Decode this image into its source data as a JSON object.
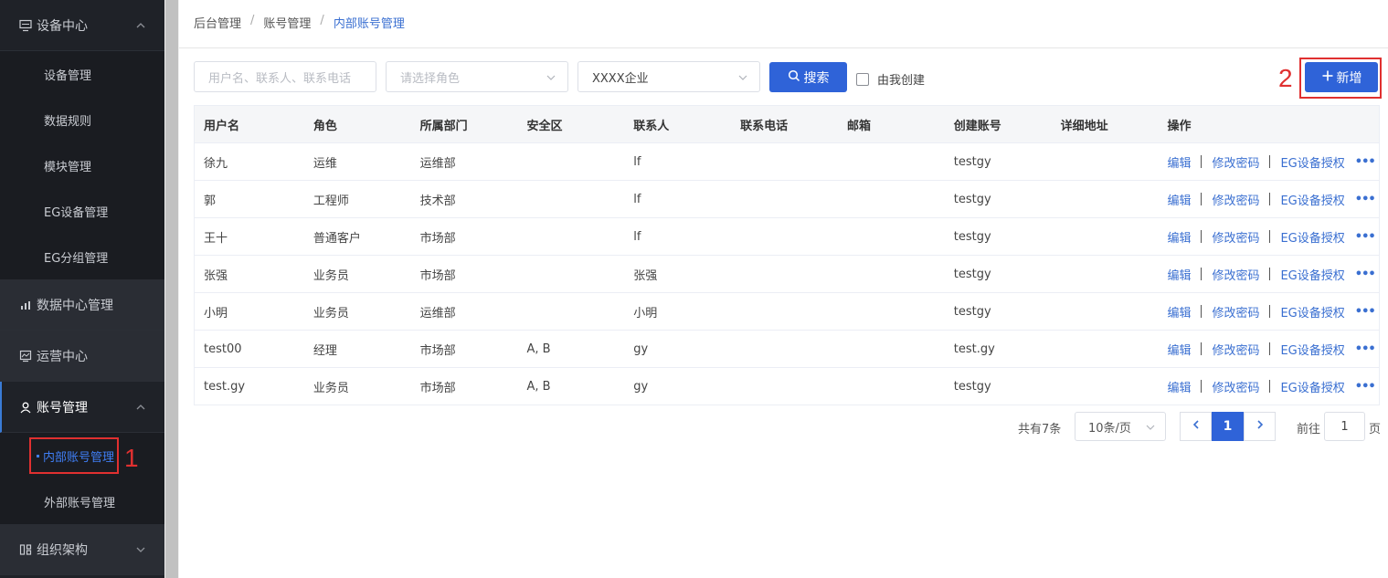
{
  "sidebar": {
    "groups": [
      {
        "label": "设备中心",
        "icon": "monitor-icon"
      },
      {
        "label": "数据中心管理",
        "icon": "chart-icon"
      },
      {
        "label": "运营中心",
        "icon": "dashboard-icon"
      },
      {
        "label": "账号管理",
        "icon": "user-icon"
      },
      {
        "label": "组织架构",
        "icon": "org-icon"
      }
    ],
    "device_items": [
      "设备管理",
      "数据规则",
      "模块管理",
      "EG设备管理",
      "EG分组管理"
    ],
    "account_items": [
      "内部账号管理",
      "外部账号管理"
    ]
  },
  "annotations": {
    "marker1": "1",
    "marker2": "2"
  },
  "breadcrumb": {
    "items": [
      "后台管理",
      "账号管理",
      "内部账号管理"
    ],
    "separator": "/"
  },
  "filters": {
    "keyword_placeholder": "用户名、联系人、联系电话",
    "role_placeholder": "请选择角色",
    "company_value": "XXXX企业",
    "search_label": "搜索",
    "created_by_me_label": "由我创建",
    "add_label": "新增"
  },
  "table": {
    "columns": [
      "用户名",
      "角色",
      "所属部门",
      "安全区",
      "联系人",
      "联系电话",
      "邮箱",
      "创建账号",
      "详细地址",
      "操作"
    ],
    "rows": [
      [
        "徐九",
        "运维",
        "运维部",
        "",
        "lf",
        "",
        "",
        "testgy",
        ""
      ],
      [
        "郭",
        "工程师",
        "技术部",
        "",
        "lf",
        "",
        "",
        "testgy",
        ""
      ],
      [
        "王十",
        "普通客户",
        "市场部",
        "",
        "lf",
        "",
        "",
        "testgy",
        ""
      ],
      [
        "张强",
        "业务员",
        "市场部",
        "",
        "张强",
        "",
        "",
        "testgy",
        ""
      ],
      [
        "小明",
        "业务员",
        "运维部",
        "",
        "小明",
        "",
        "",
        "testgy",
        ""
      ],
      [
        "test00",
        "经理",
        "市场部",
        "A, B",
        "gy",
        "",
        "",
        "test.gy",
        ""
      ],
      [
        "test.gy",
        "业务员",
        "市场部",
        "A, B",
        "gy",
        "",
        "",
        "testgy",
        ""
      ]
    ],
    "actions": {
      "edit": "编辑",
      "change_password": "修改密码",
      "eg_auth": "EG设备授权",
      "more": "•••"
    }
  },
  "pagination": {
    "total_text": "共有7条",
    "page_size": "10条/页",
    "current_page": "1",
    "goto_label": "前往",
    "goto_value": "1",
    "page_suffix": "页",
    "prev": "‹",
    "next": "›"
  },
  "colors": {
    "primary": "#2f63d8",
    "sidebar_bg": "#1f2228",
    "highlight": "#e03030",
    "link": "#3a6fd1"
  }
}
